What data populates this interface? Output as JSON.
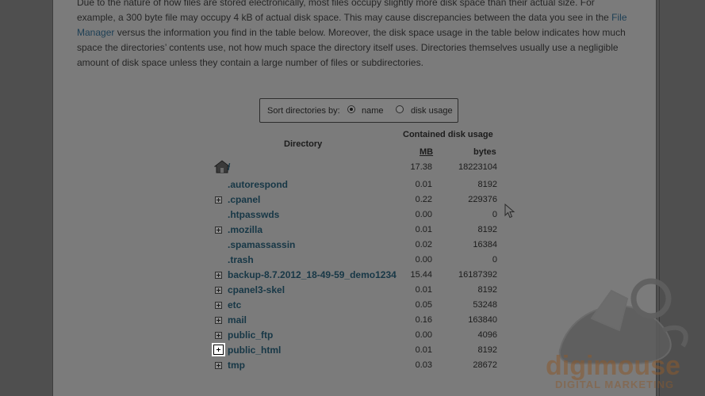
{
  "intro": {
    "line1": "Due to the nature of how files are stored electronically, most files occupy slightly more disk space than their actual size. For",
    "line2a": "example, a 300 byte file may occupy 4 kB of actual disk space. This may cause discrepancies between the data you see in the",
    "file_manager_1": "File",
    "file_manager_2": "Manager",
    "line3b": "versus the information you find in the table below. Moreover, the disk space usage in the table below indicates how much",
    "line4": "space the directories’ contents use, not how much space the directory itself uses. Directories themselves usually use a negligible",
    "line5": "amount of disk space unless they contain a large number of files or subdirectories."
  },
  "sort": {
    "label": "Sort directories by:",
    "option_name": "name",
    "option_usage": "disk usage",
    "selected": "name"
  },
  "table": {
    "col_directory": "Directory",
    "col_contained": "Contained disk usage",
    "col_mb": "MB",
    "col_bytes": "bytes",
    "rows": [
      {
        "name": "/",
        "mb": "17.38",
        "bytes": "18223104",
        "expandable": false,
        "home": true
      },
      {
        "name": ".autorespond",
        "mb": "0.01",
        "bytes": "8192",
        "expandable": false
      },
      {
        "name": ".cpanel",
        "mb": "0.22",
        "bytes": "229376",
        "expandable": true
      },
      {
        "name": ".htpasswds",
        "mb": "0.00",
        "bytes": "0",
        "expandable": false
      },
      {
        "name": ".mozilla",
        "mb": "0.01",
        "bytes": "8192",
        "expandable": true
      },
      {
        "name": ".spamassassin",
        "mb": "0.02",
        "bytes": "16384",
        "expandable": false
      },
      {
        "name": ".trash",
        "mb": "0.00",
        "bytes": "0",
        "expandable": false
      },
      {
        "name": "backup-8.7.2012_18-49-59_demo1234",
        "mb": "15.44",
        "bytes": "16187392",
        "expandable": true
      },
      {
        "name": "cpanel3-skel",
        "mb": "0.01",
        "bytes": "8192",
        "expandable": true
      },
      {
        "name": "etc",
        "mb": "0.05",
        "bytes": "53248",
        "expandable": true
      },
      {
        "name": "mail",
        "mb": "0.16",
        "bytes": "163840",
        "expandable": true
      },
      {
        "name": "public_ftp",
        "mb": "0.00",
        "bytes": "4096",
        "expandable": true
      },
      {
        "name": "public_html",
        "mb": "0.01",
        "bytes": "8192",
        "expandable": true,
        "highlighted": true
      },
      {
        "name": "tmp",
        "mb": "0.03",
        "bytes": "28672",
        "expandable": true
      }
    ]
  },
  "logo": {
    "brand": "digimouse",
    "tagline": "DIGITAL MARKETING",
    "color": "#8b5a2e"
  }
}
